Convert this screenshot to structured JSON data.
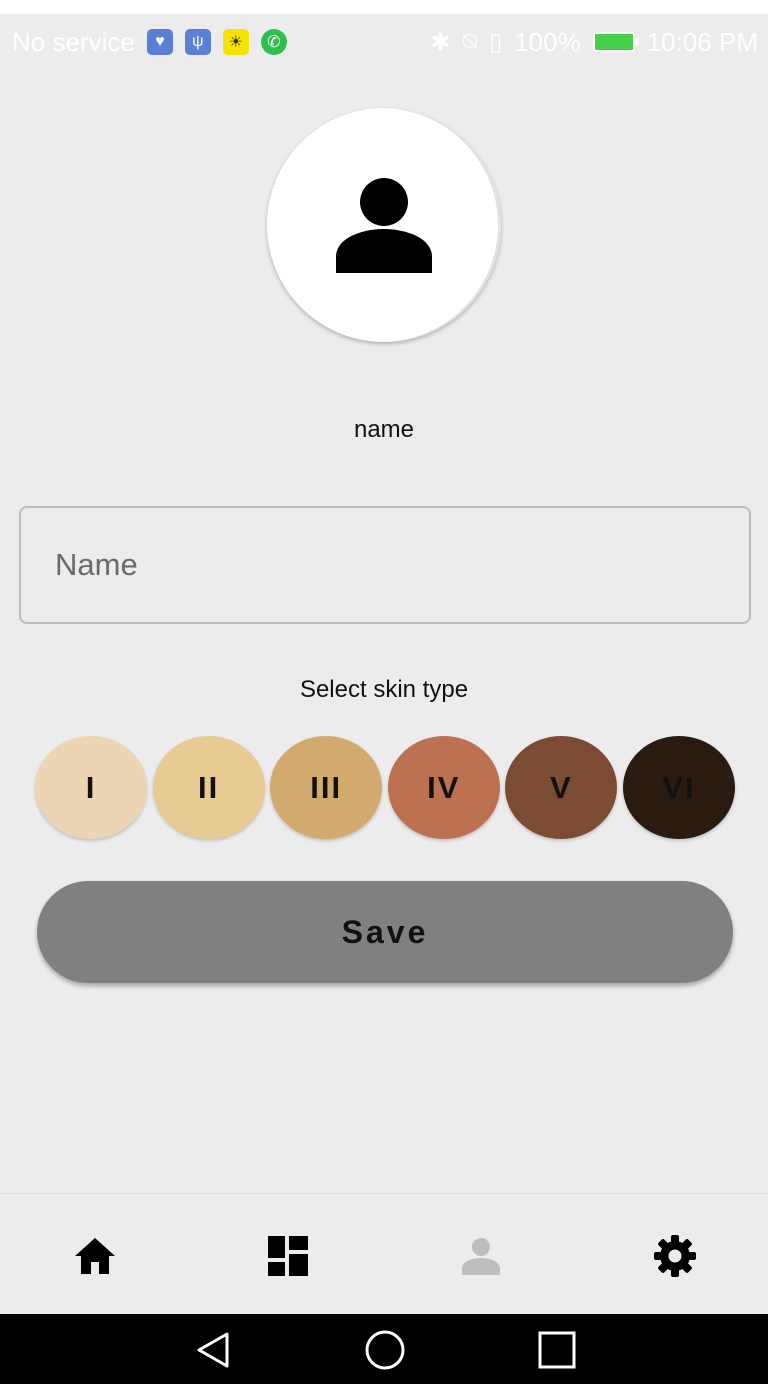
{
  "status_bar": {
    "carrier": "No service",
    "battery": "100%",
    "time": "10:06 PM",
    "left_icons": [
      "health-icon",
      "usb-icon",
      "sun-icon",
      "whatsapp-icon"
    ],
    "right_icons": [
      "bluetooth-icon",
      "mute-icon",
      "sim-icon",
      "battery-icon"
    ]
  },
  "profile": {
    "avatar_icon": "person-icon",
    "name_display": "name",
    "name_input": {
      "value": "",
      "placeholder": "Name"
    },
    "skin_type_label": "Select skin type",
    "skin_types": [
      {
        "label": "I",
        "color": "#ecd5b5"
      },
      {
        "label": "II",
        "color": "#e7cb92"
      },
      {
        "label": "III",
        "color": "#d3aa6e"
      },
      {
        "label": "IV",
        "color": "#bc7251"
      },
      {
        "label": "V",
        "color": "#7b4c33"
      },
      {
        "label": "VI",
        "color": "#2b1a10"
      }
    ],
    "save_label": "Save"
  },
  "bottom_nav": {
    "items": [
      {
        "icon": "home-icon",
        "active": true
      },
      {
        "icon": "dashboard-icon",
        "active": true
      },
      {
        "icon": "profile-icon",
        "active": false
      },
      {
        "icon": "settings-icon",
        "active": true
      }
    ]
  },
  "colors": {
    "background": "#ececec",
    "save_button": "#808080",
    "inactive_nav": "#bdbdbd"
  }
}
